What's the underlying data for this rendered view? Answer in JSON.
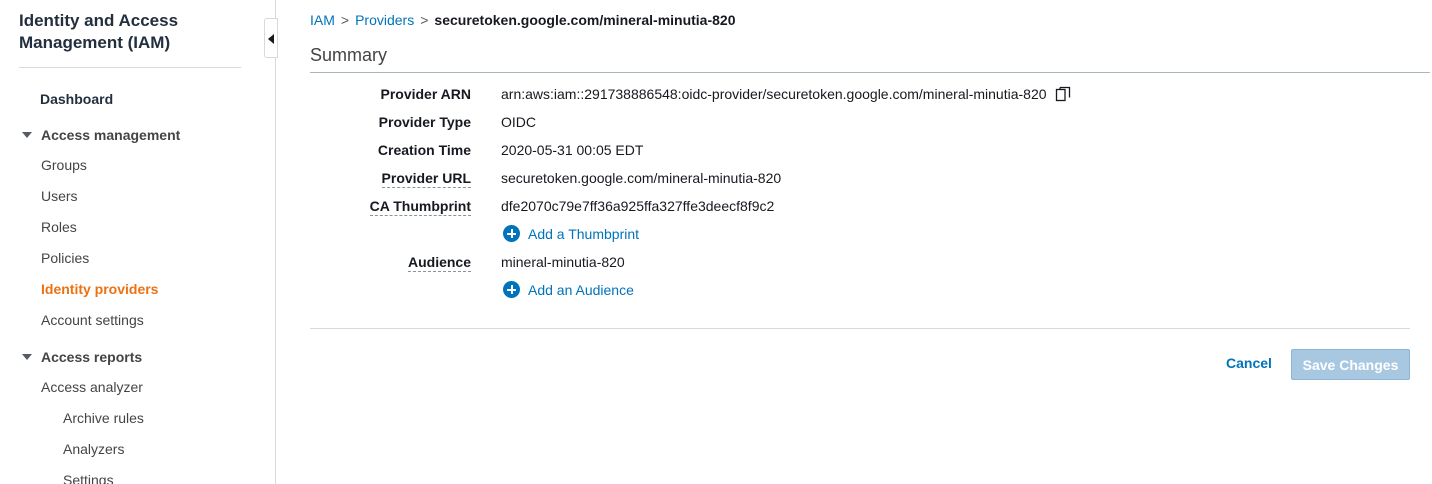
{
  "sidebar": {
    "title": "Identity and Access Management (IAM)",
    "dashboard": "Dashboard",
    "access_management": {
      "label": "Access management",
      "items": [
        "Groups",
        "Users",
        "Roles",
        "Policies",
        "Identity providers",
        "Account settings"
      ],
      "active": "Identity providers"
    },
    "access_reports": {
      "label": "Access reports",
      "items": [
        "Access analyzer"
      ],
      "subitems": [
        "Archive rules",
        "Analyzers",
        "Settings"
      ]
    }
  },
  "breadcrumb": {
    "root": "IAM",
    "sep": ">",
    "parent": "Providers",
    "current": "securetoken.google.com/mineral-minutia-820"
  },
  "summary": {
    "title": "Summary",
    "rows": {
      "provider_arn": {
        "label": "Provider ARN",
        "value": "arn:aws:iam::291738886548:oidc-provider/securetoken.google.com/mineral-minutia-820"
      },
      "provider_type": {
        "label": "Provider Type",
        "value": "OIDC"
      },
      "creation_time": {
        "label": "Creation Time",
        "value": "2020-05-31 00:05 EDT"
      },
      "provider_url": {
        "label": "Provider URL",
        "value": "securetoken.google.com/mineral-minutia-820"
      },
      "ca_thumbprint": {
        "label": "CA Thumbprint",
        "value": "dfe2070c79e7ff36a925ffa327ffe3deecf8f9c2"
      },
      "audience": {
        "label": "Audience",
        "value": "mineral-minutia-820"
      }
    },
    "add_thumbprint": "Add a Thumbprint",
    "add_audience": "Add an Audience"
  },
  "actions": {
    "cancel": "Cancel",
    "save": "Save Changes"
  },
  "colors": {
    "link": "#0073bb",
    "active_nav": "#ec7211",
    "save_disabled_bg": "#a8c8e2"
  }
}
